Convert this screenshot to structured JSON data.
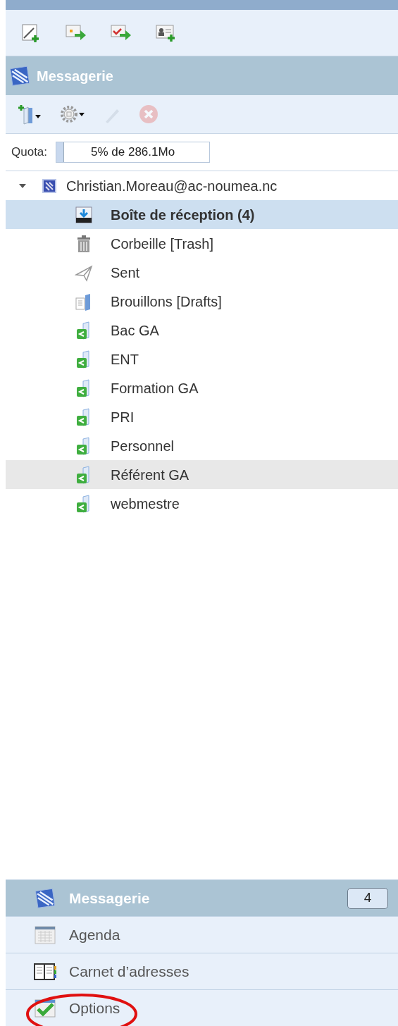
{
  "top_toolbar": [
    {
      "kind": "new-note"
    },
    {
      "kind": "calendar-export"
    },
    {
      "kind": "task-export"
    },
    {
      "kind": "new-contact"
    }
  ],
  "panel": {
    "title": "Messagerie"
  },
  "folder_toolbar": [
    {
      "kind": "folder-add",
      "disabled": false
    },
    {
      "kind": "settings",
      "disabled": false
    },
    {
      "kind": "edit",
      "disabled": true
    },
    {
      "kind": "delete",
      "disabled": true
    }
  ],
  "quota": {
    "label": "Quota:",
    "reading": "5% de 286.1Mo",
    "level": 0.05
  },
  "account": {
    "name": "Christian.Moreau@ac-noumea.nc",
    "expanded": true,
    "folders": [
      {
        "kind": "inbox",
        "name": "Boîte de réception (4)",
        "selected": true,
        "hovered": false,
        "unread": true
      },
      {
        "kind": "trash",
        "name": "Corbeille [Trash]",
        "selected": false,
        "hovered": false,
        "unread": false
      },
      {
        "kind": "sent",
        "name": "Sent",
        "selected": false,
        "hovered": false,
        "unread": false
      },
      {
        "kind": "drafts",
        "name": "Brouillons [Drafts]",
        "selected": false,
        "hovered": false,
        "unread": false
      },
      {
        "kind": "shared",
        "name": "Bac GA",
        "selected": false,
        "hovered": false,
        "unread": false
      },
      {
        "kind": "shared",
        "name": "ENT",
        "selected": false,
        "hovered": false,
        "unread": false
      },
      {
        "kind": "shared",
        "name": "Formation GA",
        "selected": false,
        "hovered": false,
        "unread": false
      },
      {
        "kind": "shared",
        "name": "PRI",
        "selected": false,
        "hovered": false,
        "unread": false
      },
      {
        "kind": "shared",
        "name": "Personnel",
        "selected": false,
        "hovered": false,
        "unread": false
      },
      {
        "kind": "shared",
        "name": "Référent GA",
        "selected": false,
        "hovered": true,
        "unread": false
      },
      {
        "kind": "shared",
        "name": "webmestre",
        "selected": false,
        "hovered": false,
        "unread": false
      }
    ]
  },
  "nav": [
    {
      "kind": "mail",
      "label": "Messagerie",
      "selected": true,
      "badge": "4",
      "circled": false
    },
    {
      "kind": "calendar",
      "label": "Agenda",
      "selected": false,
      "circled": false
    },
    {
      "kind": "contacts",
      "label": "Carnet d’adresses",
      "selected": false,
      "circled": false
    },
    {
      "kind": "options",
      "label": "Options",
      "selected": false,
      "circled": true
    }
  ]
}
